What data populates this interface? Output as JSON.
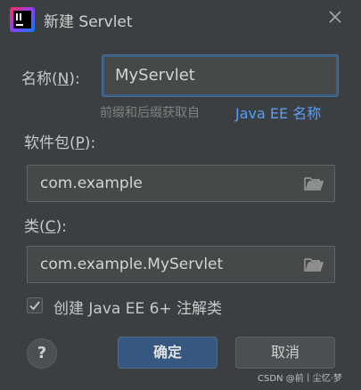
{
  "window": {
    "title": "新建 Servlet"
  },
  "form": {
    "name_label_prefix": "名称(",
    "name_label_key": "N",
    "name_label_suffix": "):",
    "name_value": "MyServlet",
    "hint_text": "前缀和后缀获取自",
    "hint_link": "Java EE 名称",
    "package_label_prefix": "软件包(",
    "package_label_key": "P",
    "package_label_suffix": "):",
    "package_value": "com.example",
    "class_label_prefix": "类(",
    "class_label_key": "C",
    "class_label_suffix": "):",
    "class_value": "com.example.MyServlet",
    "annotation_checkbox_label": "创建 Java EE 6+ 注解类",
    "annotation_checked": true
  },
  "buttons": {
    "help": "?",
    "ok": "确定",
    "cancel": "取消"
  },
  "watermark": "CSDN @前丨尘忆·梦",
  "colors": {
    "background": "#3c3f41",
    "accent": "#365880",
    "link": "#589df6",
    "focus_border": "#3d6185"
  }
}
